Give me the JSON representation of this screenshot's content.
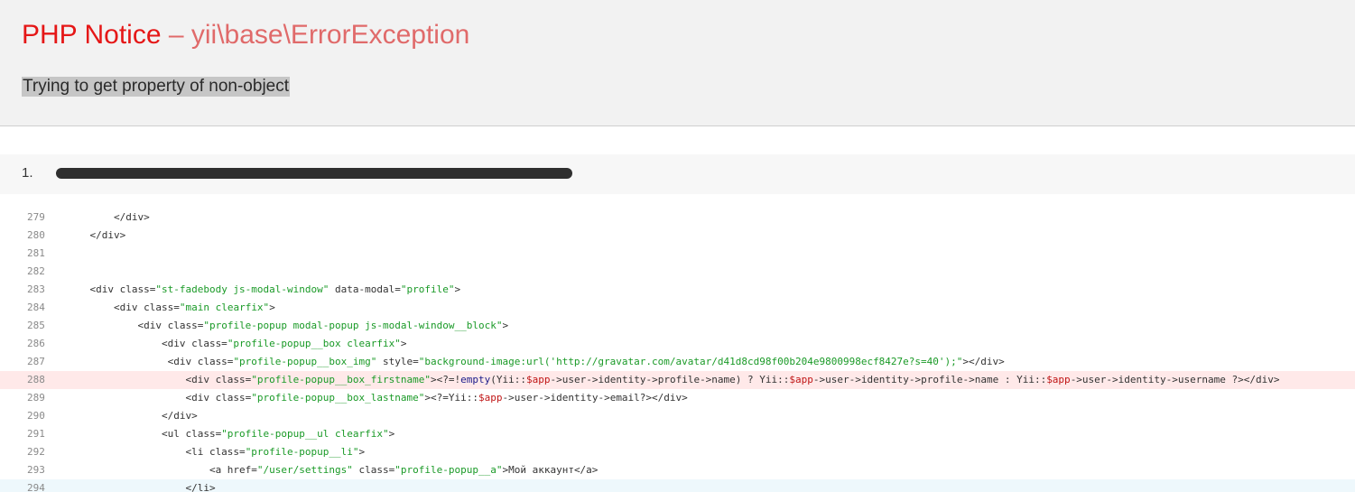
{
  "error": {
    "severity": "PHP Notice",
    "separator": " – ",
    "exception": "yii\\base\\ErrorException",
    "message": "Trying to get property of non-object"
  },
  "trace": [
    {
      "number": "1.",
      "file_redacted": true
    }
  ],
  "colors": {
    "header_bg": "#f2f2f2",
    "severity": "#e51717",
    "exception": "#e06a6a",
    "error_line_bg": "#ffe9e9",
    "string": "#1a9a27",
    "variable": "#c01515"
  },
  "code_lines": [
    {
      "num": "279",
      "highlight": "",
      "tokens": [
        {
          "t": "        </div>",
          "c": ""
        }
      ]
    },
    {
      "num": "280",
      "highlight": "",
      "tokens": [
        {
          "t": "    </div>",
          "c": ""
        }
      ]
    },
    {
      "num": "281",
      "highlight": "",
      "tokens": []
    },
    {
      "num": "282",
      "highlight": "",
      "tokens": []
    },
    {
      "num": "283",
      "highlight": "",
      "tokens": [
        {
          "t": "    <div class=",
          "c": ""
        },
        {
          "t": "\"st-fadebody js-modal-window\"",
          "c": "str"
        },
        {
          "t": " data-modal=",
          "c": ""
        },
        {
          "t": "\"profile\"",
          "c": "str"
        },
        {
          "t": ">",
          "c": ""
        }
      ]
    },
    {
      "num": "284",
      "highlight": "",
      "tokens": [
        {
          "t": "        <div class=",
          "c": ""
        },
        {
          "t": "\"main clearfix\"",
          "c": "str"
        },
        {
          "t": ">",
          "c": ""
        }
      ]
    },
    {
      "num": "285",
      "highlight": "",
      "tokens": [
        {
          "t": "            <div class=",
          "c": ""
        },
        {
          "t": "\"profile-popup modal-popup js-modal-window__block\"",
          "c": "str"
        },
        {
          "t": ">",
          "c": ""
        }
      ]
    },
    {
      "num": "286",
      "highlight": "",
      "tokens": [
        {
          "t": "                <div class=",
          "c": ""
        },
        {
          "t": "\"profile-popup__box clearfix\"",
          "c": "str"
        },
        {
          "t": ">",
          "c": ""
        }
      ]
    },
    {
      "num": "287",
      "highlight": "",
      "tokens": [
        {
          "t": "                 <div class=",
          "c": ""
        },
        {
          "t": "\"profile-popup__box_img\"",
          "c": "str"
        },
        {
          "t": " style=",
          "c": ""
        },
        {
          "t": "\"background-image:url('http://gravatar.com/avatar/d41d8cd98f00b204e9800998ecf8427e?s=40');\"",
          "c": "str"
        },
        {
          "t": "></div>",
          "c": ""
        }
      ]
    },
    {
      "num": "288",
      "highlight": "error",
      "tokens": [
        {
          "t": "                    <div class=",
          "c": ""
        },
        {
          "t": "\"profile-popup__box_firstname\"",
          "c": "str"
        },
        {
          "t": "><?=!",
          "c": ""
        },
        {
          "t": "empty",
          "c": "kw"
        },
        {
          "t": "(Yii::",
          "c": ""
        },
        {
          "t": "$app",
          "c": "var"
        },
        {
          "t": "->user->identity->profile->name) ? Yii::",
          "c": ""
        },
        {
          "t": "$app",
          "c": "var"
        },
        {
          "t": "->user->identity->profile->name : Yii::",
          "c": ""
        },
        {
          "t": "$app",
          "c": "var"
        },
        {
          "t": "->user->identity->username ?></div>",
          "c": ""
        }
      ]
    },
    {
      "num": "289",
      "highlight": "",
      "tokens": [
        {
          "t": "                    <div class=",
          "c": ""
        },
        {
          "t": "\"profile-popup__box_lastname\"",
          "c": "str"
        },
        {
          "t": "><?=Yii::",
          "c": ""
        },
        {
          "t": "$app",
          "c": "var"
        },
        {
          "t": "->user->identity->email?></div>",
          "c": ""
        }
      ]
    },
    {
      "num": "290",
      "highlight": "",
      "tokens": [
        {
          "t": "                </div>",
          "c": ""
        }
      ]
    },
    {
      "num": "291",
      "highlight": "",
      "tokens": [
        {
          "t": "                <ul class=",
          "c": ""
        },
        {
          "t": "\"profile-popup__ul clearfix\"",
          "c": "str"
        },
        {
          "t": ">",
          "c": ""
        }
      ]
    },
    {
      "num": "292",
      "highlight": "",
      "tokens": [
        {
          "t": "                    <li class=",
          "c": ""
        },
        {
          "t": "\"profile-popup__li\"",
          "c": "str"
        },
        {
          "t": ">",
          "c": ""
        }
      ]
    },
    {
      "num": "293",
      "highlight": "",
      "tokens": [
        {
          "t": "                        <a href=",
          "c": ""
        },
        {
          "t": "\"/user/settings\"",
          "c": "str"
        },
        {
          "t": " class=",
          "c": ""
        },
        {
          "t": "\"profile-popup__a\"",
          "c": "str"
        },
        {
          "t": ">Мой аккаунт</a>",
          "c": ""
        }
      ]
    },
    {
      "num": "294",
      "highlight": "hover",
      "tokens": [
        {
          "t": "                    </li>",
          "c": ""
        }
      ]
    }
  ]
}
